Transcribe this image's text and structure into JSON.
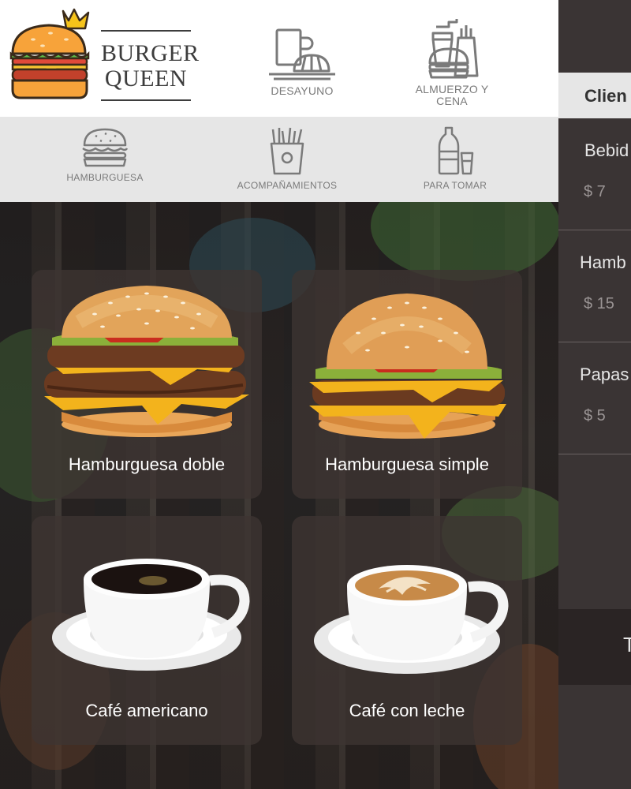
{
  "brand": {
    "line1": "BURGER",
    "line2": "QUEEN"
  },
  "meal_tabs": [
    {
      "label": "DESAYUNO",
      "icon": "coffee-croissant-icon"
    },
    {
      "label": "ALMUERZO Y CENA",
      "icon": "combo-meal-icon"
    }
  ],
  "categories": [
    {
      "label": "HAMBURGUESA",
      "icon": "hamburger-icon"
    },
    {
      "label": "ACOMPAÑAMIENTOS",
      "icon": "fries-icon"
    },
    {
      "label": "PARA TOMAR",
      "icon": "drinks-icon"
    }
  ],
  "products": [
    {
      "name": "Hamburguesa doble",
      "image": "double-burger"
    },
    {
      "name": "Hamburguesa simple",
      "image": "simple-burger"
    },
    {
      "name": "Café americano",
      "image": "black-coffee-cup"
    },
    {
      "name": "Café con leche",
      "image": "latte-cup"
    }
  ],
  "order": {
    "client_label": "Clien",
    "items": [
      {
        "name": "Bebid",
        "price": "$ 7"
      },
      {
        "name": "Hamb",
        "price": "$ 15"
      },
      {
        "name": "Papas",
        "price": "$ 5"
      }
    ],
    "total_label": "T"
  },
  "colors": {
    "header_bg": "#ffffff",
    "catbar_bg": "#e6e6e6",
    "panel_bg": "#3a3434",
    "card_bg": "#3e3432",
    "icon_gray": "#7a7a7a"
  }
}
